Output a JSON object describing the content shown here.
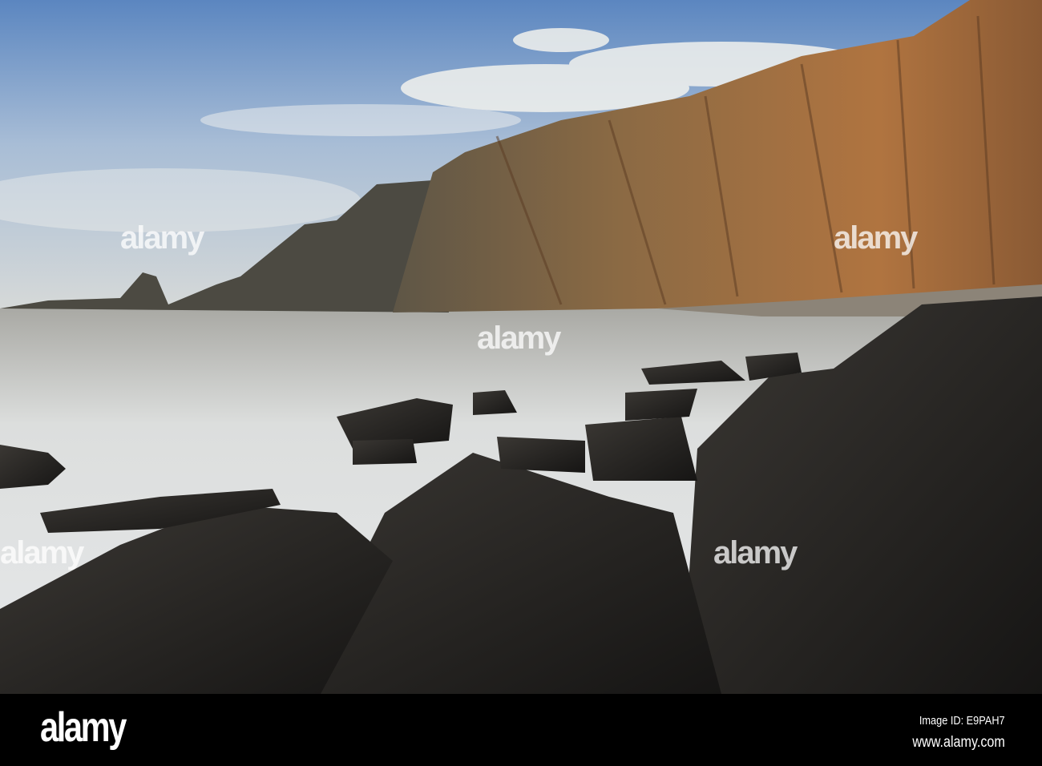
{
  "photo": {
    "subject": "Rocky coastline with folded sea cliffs",
    "colors": {
      "sky": "#6f93c4",
      "cliff": "#9a6a3a",
      "rock": "#2a2a2a",
      "sea": "#d6d8da"
    }
  },
  "watermark": {
    "text": "alamy"
  },
  "footer": {
    "logo": "alamy",
    "image_id": "Image ID: E9PAH7",
    "website": "www.alamy.com"
  }
}
